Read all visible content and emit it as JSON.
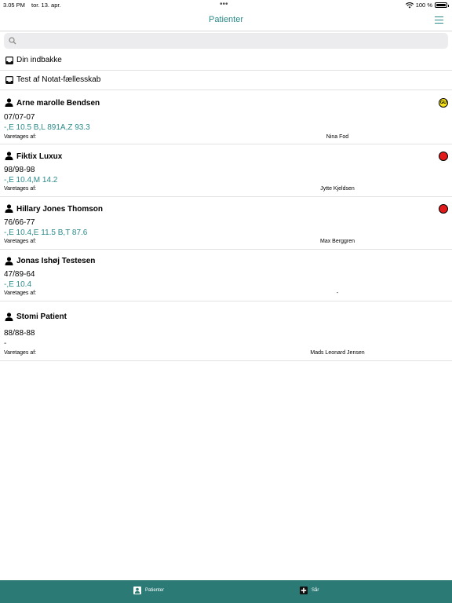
{
  "status_bar": {
    "time": "3.05 PM",
    "date": "tor. 13. apr.",
    "dots": "•••",
    "battery": "100 %"
  },
  "nav": {
    "title": "Patienter"
  },
  "search": {
    "placeholder": ""
  },
  "inboxes": [
    {
      "label": "Din indbakke"
    },
    {
      "label": "Test af Notat-fællesskab"
    }
  ],
  "care_label": "Varetages af:",
  "patients": [
    {
      "name": "Arne marolle Bendsen",
      "id": "07/07-07",
      "codes": "-,E 10.5 B,L 891A,Z 93.3",
      "caretaker": "Nina Fod",
      "badge": {
        "text": "GU",
        "color": "#f4e11a"
      }
    },
    {
      "name": "Fiktix Luxux",
      "id": "98/98-98",
      "codes": "-,E 10.4,M 14.2",
      "caretaker": "Jytte Kjeldsen",
      "badge": {
        "text": "",
        "color": "#e11b1b"
      }
    },
    {
      "name": "Hillary Jones Thomson",
      "id": "76/66-77",
      "codes": "-,E 10.4,E 11.5 B,T 87.6",
      "caretaker": "Max Berggren",
      "badge": {
        "text": "",
        "color": "#e11b1b"
      }
    },
    {
      "name": "Jonas Ishøj Testesen",
      "id": "47/89-64",
      "codes": "-,E 10.4",
      "caretaker": "-",
      "badge": null
    },
    {
      "name": "Stomi Patient",
      "id": "88/88-88",
      "codes": "-",
      "caretaker": "Mads Leonard Jensen",
      "badge": null
    }
  ],
  "tabs": [
    {
      "label": "Patienter",
      "icon": "person-card-icon"
    },
    {
      "label": "Sår",
      "icon": "plus-box-icon"
    }
  ]
}
